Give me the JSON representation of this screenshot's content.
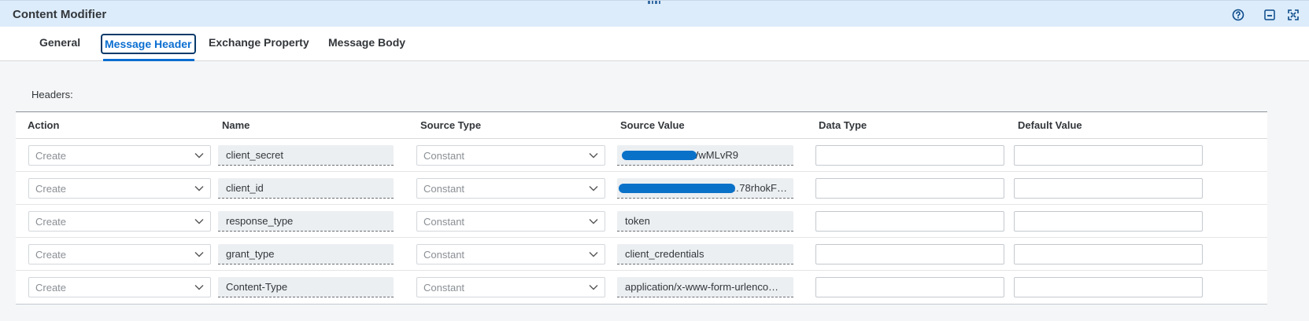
{
  "window": {
    "title": "Content Modifier"
  },
  "toolbar": {
    "help_icon": "help-circle-icon",
    "minimize_icon": "minimize-icon",
    "fullscreen_icon": "fullscreen-icon"
  },
  "tabs": [
    {
      "label": "General",
      "active": false
    },
    {
      "label": "Message Header",
      "active": true
    },
    {
      "label": "Exchange Property",
      "active": false
    },
    {
      "label": "Message Body",
      "active": false
    }
  ],
  "headers_section": {
    "label": "Headers:"
  },
  "table": {
    "columns": [
      "Action",
      "Name",
      "Source Type",
      "Source Value",
      "Data Type",
      "Default Value"
    ],
    "rows": [
      {
        "action": "Create",
        "name": "client_secret",
        "source_type": "Constant",
        "source_value": "…6WwMLvR9",
        "source_value_redacted": true,
        "data_type": "",
        "default_value": ""
      },
      {
        "action": "Create",
        "name": "client_id",
        "source_type": "Constant",
        "source_value": "…78rhokF…",
        "source_value_redacted": true,
        "data_type": "",
        "default_value": ""
      },
      {
        "action": "Create",
        "name": "response_type",
        "source_type": "Constant",
        "source_value": "token",
        "source_value_redacted": false,
        "data_type": "",
        "default_value": ""
      },
      {
        "action": "Create",
        "name": "grant_type",
        "source_type": "Constant",
        "source_value": "client_credentials",
        "source_value_redacted": false,
        "data_type": "",
        "default_value": ""
      },
      {
        "action": "Create",
        "name": "Content-Type",
        "source_type": "Constant",
        "source_value": "application/x-www-form-urlenco…",
        "source_value_redacted": false,
        "data_type": "",
        "default_value": ""
      }
    ]
  },
  "colors": {
    "accent": "#0a6ed1",
    "titlebar_bg": "#dcecfb",
    "redaction": "#0a71c9"
  }
}
